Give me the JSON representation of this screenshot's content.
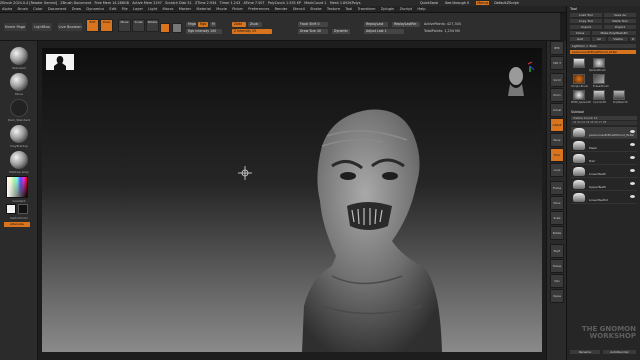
{
  "app": {
    "title_segments": [
      "ZBrush 2024.0.4 [Reader Gemini]",
      "ZBrush Document",
      "Free Mem 14.286GB",
      "Active Mem 2197",
      "Scratch Disk 51",
      "ZTime 2.934",
      "Timer 1.243",
      "ATime 7.507",
      "PolyCount 1.535 KP",
      "MeshCount 1",
      "Mesh 1.892KPolys"
    ],
    "right_status": [
      "QuickSave",
      "See-through 0",
      "Menus",
      "DefaultZScript"
    ]
  },
  "menus": [
    "Alpha",
    "Brush",
    "Color",
    "Document",
    "Draw",
    "Dynamics",
    "Edit",
    "File",
    "Layer",
    "Light",
    "Macro",
    "Marker",
    "Material",
    "Movie",
    "Picker",
    "Preferences",
    "Render",
    "Stencil",
    "Stroke",
    "Texture",
    "Tool",
    "Transform",
    "Zplugin",
    "Zscript",
    "Help"
  ],
  "toolbar": {
    "tabs": [
      "Home Page",
      "LightBox",
      "Live Boolean"
    ],
    "mode_buttons": [
      "Edit",
      "Draw",
      "Move",
      "Scale",
      "Rotate"
    ],
    "mrgb": "Mrgb",
    "rgb": "Rgb",
    "m": "M",
    "zadd": "Zadd",
    "zsub": "Zsub",
    "rgb_intensity": "Rgb Intensity 100",
    "z_intensity": "Z Intensity 25",
    "focal_shift": "Focal Shift 0",
    "draw_size": "Draw Size 40",
    "dynamic": "Dynamic",
    "active_points": "ActivePoints: 427,304",
    "total_points": "TotalPoints: 1,254 Mil",
    "replay_last": "ReplayLast",
    "replay_last_rel": "ReplayLastRel",
    "adjust": "Adjust Last 1"
  },
  "left_shelf": {
    "brushes": [
      "Standard",
      "Move",
      "Dam_Standard",
      "ClayBuildup",
      "MatCap Gray"
    ],
    "gradient": "Gradient",
    "switch_color": "SwitchColor",
    "alternate": "Alternate"
  },
  "right_shelf": [
    "BPR",
    "SPix 3",
    "Scroll",
    "Zoom",
    "Actual",
    "AAHalf",
    "Persp",
    "Floor",
    "Local",
    "Frame",
    "Move",
    "Scale",
    "Rotate",
    "PolyF",
    "Transp",
    "Solo",
    "Xpose"
  ],
  "tray": {
    "header": "Tool",
    "buttons": [
      "Load Tool",
      "Save As",
      "Copy Tool",
      "Paste Tool",
      "Import",
      "Export",
      "Clone",
      "Make PolyMesh3D",
      "GoZ",
      "All",
      "Visible",
      "R"
    ],
    "lightbox_tools": "Lightbox > Tools",
    "current_tool": "pavlusmed03hwDShrud_PLR2",
    "tool_thumbs": [
      "SphereBrush",
      "Simple Brush",
      "EraserBrush",
      "PM3D_Sphere3D",
      "Cylinder3D",
      "PolyMesh3D"
    ],
    "subtool_header": "Subtool",
    "visible_count": "Visible Count 11",
    "subtools": [
      "pavlusmed03hwDShrud_PLR2",
      "Mesh",
      "Hair",
      "LowerTeeth",
      "UpperTeeth",
      "LowerTeeth2"
    ],
    "bottom": [
      "Rename",
      "AutoReorder"
    ]
  },
  "watermark": [
    "THE GNOMON",
    "WORKSHOP"
  ]
}
